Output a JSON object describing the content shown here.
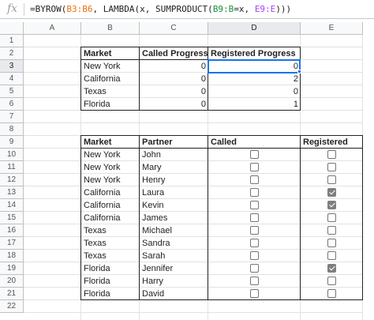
{
  "formula_bar": {
    "icon": "fx-icon",
    "label": "fx",
    "parts": [
      {
        "text": "=BYROW(",
        "ref": false
      },
      {
        "text": "B3:B6",
        "ref": "r1"
      },
      {
        "text": ", LAMBDA(x, SUMPRODUCT(",
        "ref": false
      },
      {
        "text": "B9:B",
        "ref": "r2"
      },
      {
        "text": "=x, ",
        "ref": false
      },
      {
        "text": "E9:E",
        "ref": "r3"
      },
      {
        "text": ")))",
        "ref": false
      }
    ]
  },
  "columns": [
    "A",
    "B",
    "C",
    "D",
    "E"
  ],
  "rows": [
    "1",
    "2",
    "3",
    "4",
    "5",
    "6",
    "7",
    "8",
    "9",
    "10",
    "11",
    "12",
    "13",
    "14",
    "15",
    "16",
    "17",
    "18",
    "19",
    "20",
    "21",
    "22"
  ],
  "selected": {
    "column": "D",
    "row": "3"
  },
  "summary_table": {
    "headers": [
      "Market",
      "Called Progress",
      "Registered Progress"
    ],
    "rows": [
      {
        "market": "New York",
        "called": "0",
        "registered": "0"
      },
      {
        "market": "California",
        "called": "0",
        "registered": "2"
      },
      {
        "market": "Texas",
        "called": "0",
        "registered": "0"
      },
      {
        "market": "Florida",
        "called": "0",
        "registered": "1"
      }
    ]
  },
  "detail_table": {
    "headers": [
      "Market",
      "Partner",
      "Called",
      "Registered"
    ],
    "rows": [
      {
        "market": "New York",
        "partner": "John",
        "called": false,
        "registered": false
      },
      {
        "market": "New York",
        "partner": "Mary",
        "called": false,
        "registered": false
      },
      {
        "market": "New York",
        "partner": "Henry",
        "called": false,
        "registered": false
      },
      {
        "market": "California",
        "partner": "Laura",
        "called": false,
        "registered": true
      },
      {
        "market": "California",
        "partner": "Kevin",
        "called": false,
        "registered": true
      },
      {
        "market": "California",
        "partner": "James",
        "called": false,
        "registered": false
      },
      {
        "market": "Texas",
        "partner": "Michael",
        "called": false,
        "registered": false
      },
      {
        "market": "Texas",
        "partner": "Sandra",
        "called": false,
        "registered": false
      },
      {
        "market": "Texas",
        "partner": "Sarah",
        "called": false,
        "registered": false
      },
      {
        "market": "Florida",
        "partner": "Jennifer",
        "called": false,
        "registered": true
      },
      {
        "market": "Florida",
        "partner": "Harry",
        "called": false,
        "registered": false
      },
      {
        "market": "Florida",
        "partner": "David",
        "called": false,
        "registered": false
      }
    ]
  },
  "colors": {
    "selection": "#1a73e8",
    "checkbox_checked": "#7f7f7f"
  }
}
